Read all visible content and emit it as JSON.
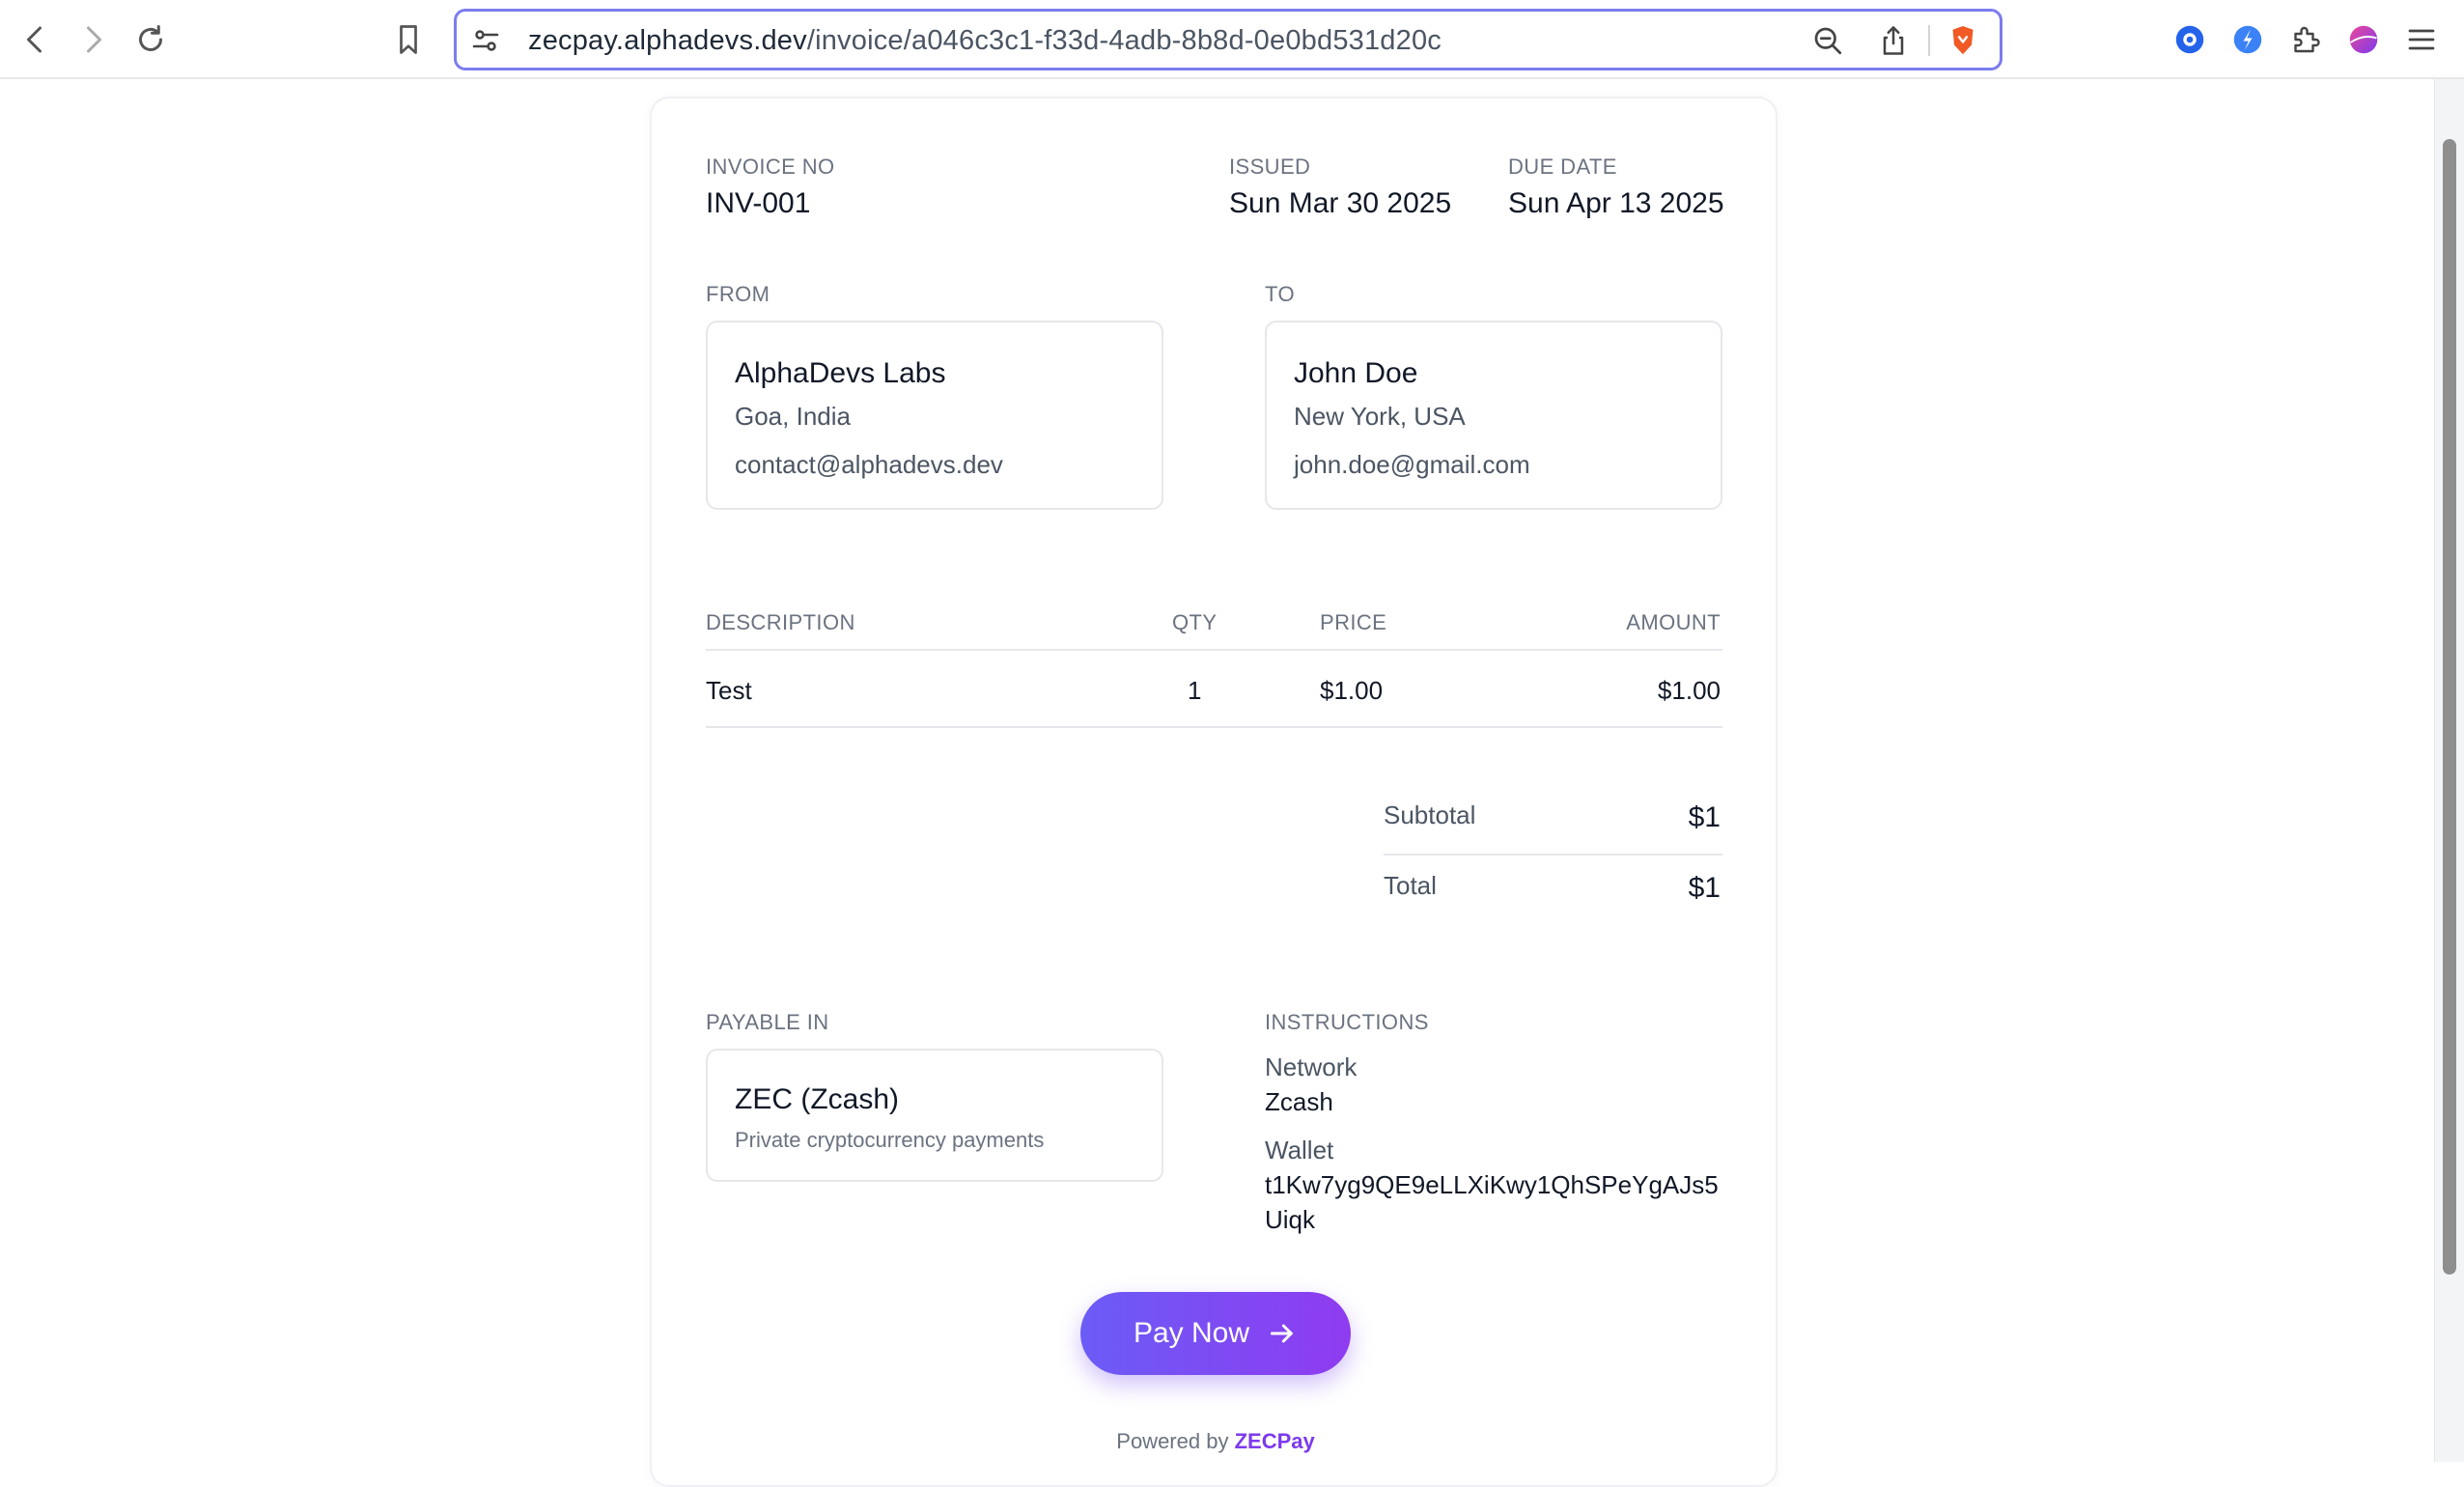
{
  "browser": {
    "url_domain": "zecpay.alphadevs.dev",
    "url_path": "/invoice/a046c3c1-f33d-4adb-8b8d-0e0bd531d20c",
    "icons": [
      "back-icon",
      "forward-icon",
      "reload-icon",
      "bookmark-icon",
      "site-settings-icon",
      "zoom-out-icon",
      "share-icon",
      "brave-shields-icon",
      "extension-1-icon",
      "extension-2-icon",
      "extensions-puzzle-icon",
      "profile-avatar-icon",
      "menu-icon"
    ]
  },
  "invoice": {
    "number_label": "INVOICE NO",
    "number": "INV-001",
    "issued_label": "ISSUED",
    "issued": "Sun Mar 30 2025",
    "due_label": "DUE DATE",
    "due": "Sun Apr 13 2025"
  },
  "from": {
    "label": "FROM",
    "name": "AlphaDevs Labs",
    "location": "Goa, India",
    "email": "contact@alphadevs.dev"
  },
  "to": {
    "label": "TO",
    "name": "John Doe",
    "location": "New York, USA",
    "email": "john.doe@gmail.com"
  },
  "items": {
    "headers": {
      "description": "DESCRIPTION",
      "qty": "QTY",
      "price": "PRICE",
      "amount": "AMOUNT"
    },
    "rows": [
      {
        "description": "Test",
        "qty": "1",
        "price": "$1.00",
        "amount": "$1.00"
      }
    ]
  },
  "totals": {
    "subtotal_label": "Subtotal",
    "subtotal": "$1",
    "total_label": "Total",
    "total": "$1"
  },
  "payment": {
    "payable_label": "PAYABLE IN",
    "currency": "ZEC (Zcash)",
    "currency_desc": "Private cryptocurrency payments",
    "instructions_label": "INSTRUCTIONS",
    "network_label": "Network",
    "network": "Zcash",
    "wallet_label": "Wallet",
    "wallet_line1": "t1Kw7yg9QE9eLLXiKwy1QhSPeYgAJs5",
    "wallet_line2": "Uiqk"
  },
  "actions": {
    "pay_now": "Pay Now"
  },
  "footer": {
    "powered_by": "Powered by",
    "brand": "ZECPay"
  },
  "colors": {
    "accent_start": "#6b5cf6",
    "accent_end": "#8f3bf0",
    "url_focus": "#7c7cf0"
  }
}
